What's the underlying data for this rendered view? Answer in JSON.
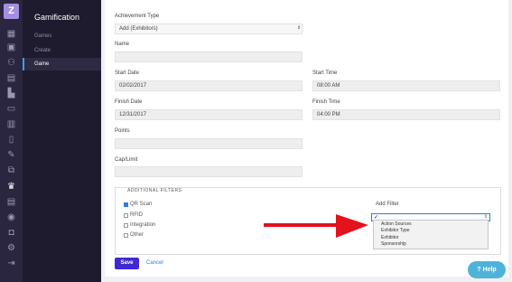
{
  "app": {
    "logo_text": "Z",
    "section_title": "Gamification"
  },
  "sidebar": {
    "items": [
      {
        "label": "Games"
      },
      {
        "label": "Create"
      },
      {
        "label": "Game"
      }
    ]
  },
  "form": {
    "achievement_type": {
      "label": "Achievement Type",
      "value": "Add (Exhibitors)"
    },
    "name": {
      "label": "Name",
      "value": ""
    },
    "start_date": {
      "label": "Start Date",
      "value": "02/02/2017"
    },
    "start_time": {
      "label": "Start Time",
      "value": "08:00 AM"
    },
    "finish_date": {
      "label": "Finish Date",
      "value": "12/31/2017"
    },
    "finish_time": {
      "label": "Finish Time",
      "value": "04:00 PM"
    },
    "points": {
      "label": "Points",
      "value": ""
    },
    "cap_limit": {
      "label": "Cap/Limit",
      "value": ""
    }
  },
  "filters": {
    "title": "ADDITIONAL FILTERS",
    "checkboxes": [
      {
        "label": "QR Scan",
        "checked": true
      },
      {
        "label": "RFID",
        "checked": false
      },
      {
        "label": "Integration",
        "checked": false
      },
      {
        "label": "Other",
        "checked": false
      }
    ],
    "add_filter": {
      "label": "Add Filter",
      "options": [
        "Action Sources",
        "Exhibitor Type",
        "Exhibitor",
        "Sponsorship"
      ]
    }
  },
  "actions": {
    "save_label": "Save",
    "cancel_label": "Cancel"
  },
  "help": {
    "label": "Help"
  },
  "colors": {
    "accent": "#3f2ad0",
    "arrow": "#e3121b",
    "sidebar": "#1e1b2e"
  }
}
